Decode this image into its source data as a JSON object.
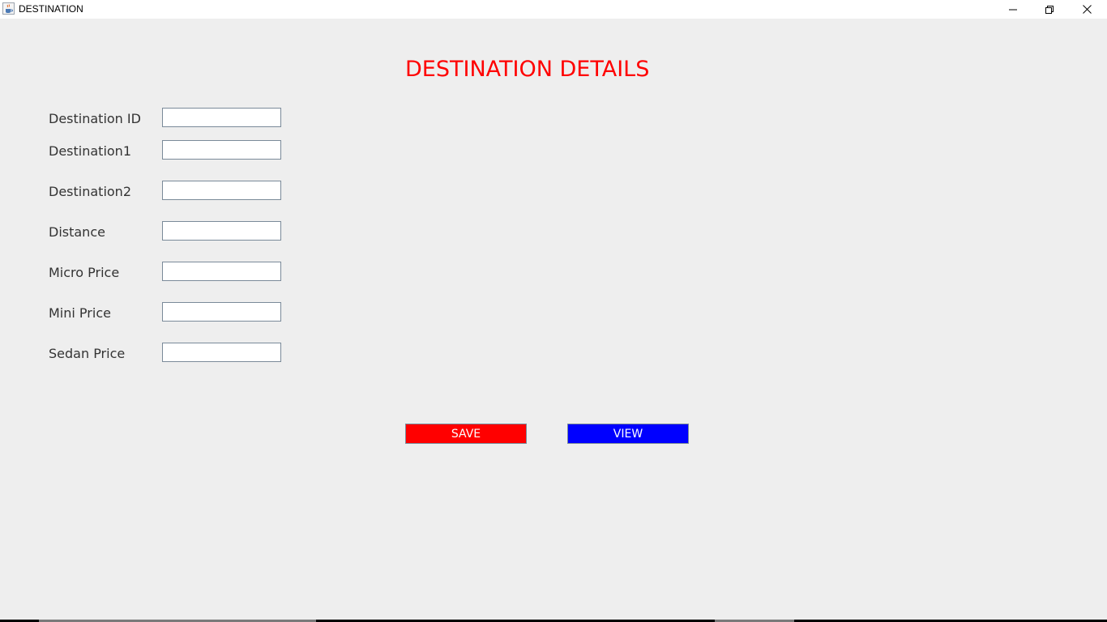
{
  "window": {
    "title": "DESTINATION",
    "icon": "java-cup-icon",
    "controls": [
      "minimize-icon",
      "restore-icon",
      "close-icon"
    ]
  },
  "page": {
    "heading": "DESTINATION DETAILS",
    "heading_color": "#ff0000"
  },
  "form": {
    "fields": [
      {
        "label": "Destination ID",
        "value": ""
      },
      {
        "label": "Destination1",
        "value": ""
      },
      {
        "label": "Destination2",
        "value": ""
      },
      {
        "label": "Distance",
        "value": ""
      },
      {
        "label": "Micro Price",
        "value": ""
      },
      {
        "label": "Mini Price",
        "value": ""
      },
      {
        "label": "Sedan Price",
        "value": ""
      }
    ]
  },
  "actions": {
    "save_label": "SAVE",
    "save_color": "#ff0000",
    "view_label": "VIEW",
    "view_color": "#0000ff"
  }
}
